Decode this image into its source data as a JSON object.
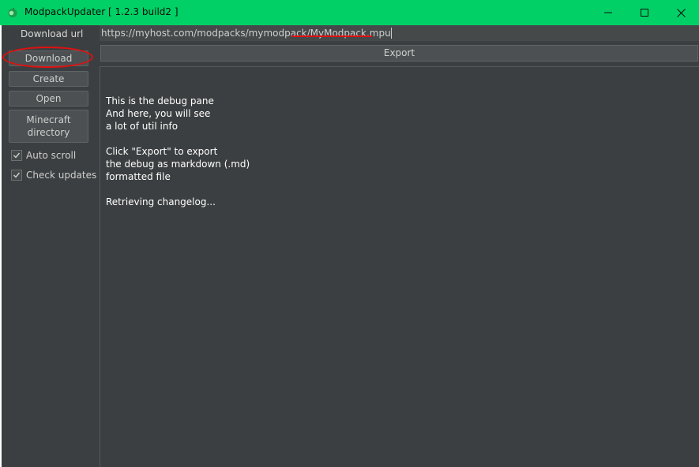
{
  "window": {
    "title": "ModpackUpdater [ 1.2.3 build2 ]",
    "accent_color": "#00d065",
    "background_color": "#3c3f41"
  },
  "titlebar_controls": {
    "minimize_icon": "minimize-icon",
    "maximize_icon": "maximize-icon",
    "close_icon": "close-icon"
  },
  "sidebar": {
    "download_url_label": "Download url",
    "download_label": "Download",
    "create_label": "Create",
    "open_label": "Open",
    "minecraft_dir_line1": "Minecraft",
    "minecraft_dir_line2": "directory",
    "auto_scroll_label": "Auto scroll",
    "auto_scroll_checked": true,
    "check_updates_label": "Check updates",
    "check_updates_checked": true
  },
  "url_field": {
    "value_prefix": "https://myhost.com/modpacks/mymodpack/",
    "value_file": "MyModpack.mpu"
  },
  "export_label": "Export",
  "debug_lines": [
    "This is the debug pane",
    "And here, you will see",
    "a lot of util info",
    "",
    "Click \"Export\" to export",
    "the debug as markdown (.md)",
    "formatted file",
    "",
    "Retrieving changelog..."
  ],
  "annotations": {
    "highlight_color": "#e01010"
  }
}
